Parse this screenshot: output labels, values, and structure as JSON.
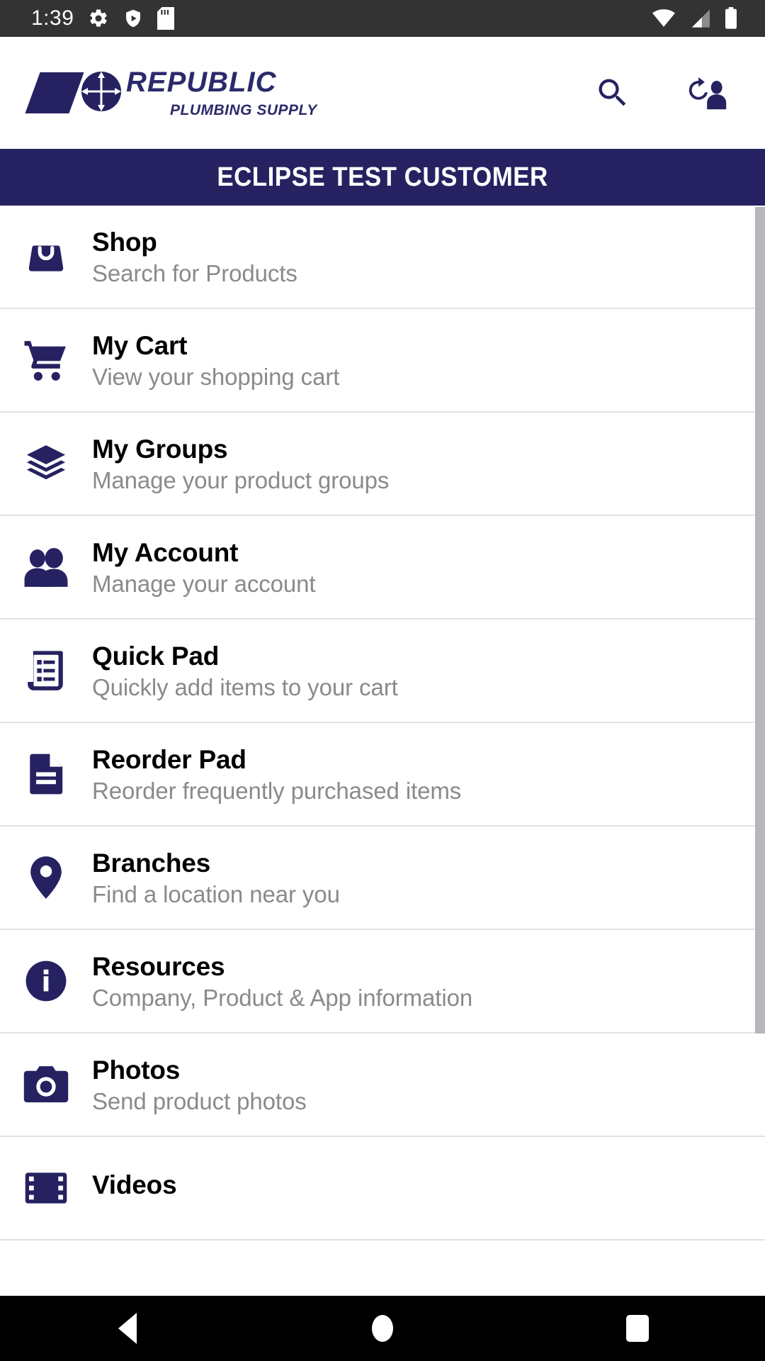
{
  "status_bar": {
    "time": "1:39",
    "left_icons": [
      "settings-gear-icon",
      "play-protect-shield-icon",
      "sd-card-icon"
    ],
    "right_icons": [
      "wifi-icon",
      "cellular-signal-icon",
      "battery-icon"
    ]
  },
  "header": {
    "logo_line1": "REPUBLIC",
    "logo_line2": "PLUMBING SUPPLY",
    "search_icon": "search-icon",
    "switch_user_icon": "switch-user-icon"
  },
  "customer_banner": {
    "label": "ECLIPSE TEST CUSTOMER"
  },
  "menu": {
    "items": [
      {
        "icon": "shopping-bag-icon",
        "title": "Shop",
        "subtitle": "Search for Products"
      },
      {
        "icon": "shopping-cart-icon",
        "title": "My Cart",
        "subtitle": "View your shopping cart"
      },
      {
        "icon": "layers-icon",
        "title": "My Groups",
        "subtitle": "Manage your product groups"
      },
      {
        "icon": "people-icon",
        "title": "My Account",
        "subtitle": "Manage your account"
      },
      {
        "icon": "receipt-list-icon",
        "title": "Quick Pad",
        "subtitle": "Quickly add items to your cart"
      },
      {
        "icon": "document-icon",
        "title": "Reorder Pad",
        "subtitle": "Reorder frequently purchased items"
      },
      {
        "icon": "map-pin-icon",
        "title": "Branches",
        "subtitle": "Find a location near you"
      },
      {
        "icon": "info-circle-icon",
        "title": "Resources",
        "subtitle": "Company, Product & App information"
      },
      {
        "icon": "camera-icon",
        "title": "Photos",
        "subtitle": "Send product photos"
      },
      {
        "icon": "video-film-icon",
        "title": "Videos",
        "subtitle": ""
      }
    ]
  },
  "nav_bar": {
    "back": "back-button",
    "home": "home-button",
    "recents": "recents-button"
  },
  "colors": {
    "brand_navy": "#262261",
    "status_bar": "#333333",
    "title_text": "#000000",
    "subtitle_text": "#8a8a8a",
    "divider": "#e2e2e2",
    "scrollbar": "#b7b7bb"
  }
}
